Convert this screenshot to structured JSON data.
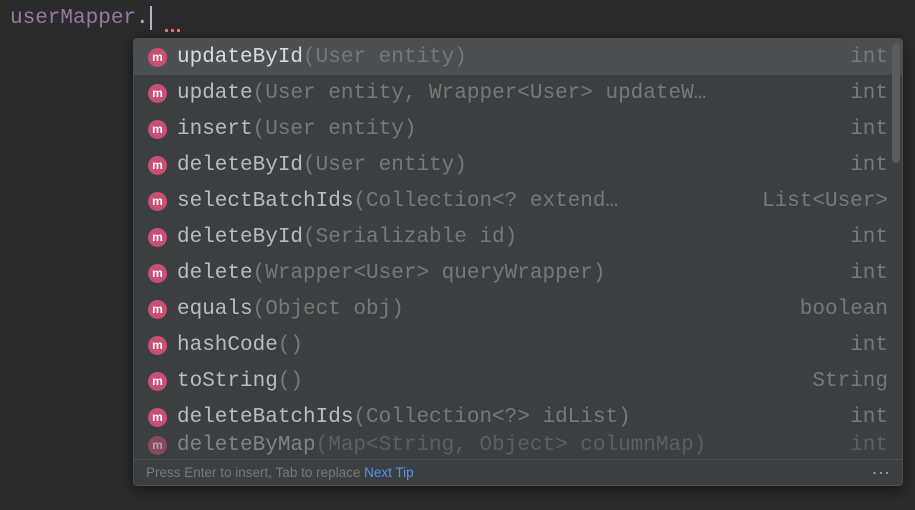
{
  "editor": {
    "identifier": "userMapper",
    "dot": "."
  },
  "popup": {
    "items": [
      {
        "icon": "m",
        "name": "updateById",
        "params": "(User entity)",
        "ret": "int",
        "selected": true
      },
      {
        "icon": "m",
        "name": "update",
        "params": "(User entity, Wrapper<User> updateW…",
        "ret": "int"
      },
      {
        "icon": "m",
        "name": "insert",
        "params": "(User entity)",
        "ret": "int"
      },
      {
        "icon": "m",
        "name": "deleteById",
        "params": "(User entity)",
        "ret": "int"
      },
      {
        "icon": "m",
        "name": "selectBatchIds",
        "params": "(Collection<? extend…",
        "ret": "List<User>"
      },
      {
        "icon": "m",
        "name": "deleteById",
        "params": "(Serializable id)",
        "ret": "int"
      },
      {
        "icon": "m",
        "name": "delete",
        "params": "(Wrapper<User> queryWrapper)",
        "ret": "int"
      },
      {
        "icon": "m",
        "name": "equals",
        "params": "(Object obj)",
        "ret": "boolean"
      },
      {
        "icon": "m",
        "name": "hashCode",
        "params": "()",
        "ret": "int"
      },
      {
        "icon": "m",
        "name": "toString",
        "params": "()",
        "ret": "String"
      },
      {
        "icon": "m",
        "name": "deleteBatchIds",
        "params": "(Collection<?> idList)",
        "ret": "int"
      },
      {
        "icon": "m",
        "name": "deleteByMap",
        "params": "(Map<String, Object> columnMap)",
        "ret": "int",
        "partial": true
      }
    ],
    "footer": {
      "hint": "Press Enter to insert, Tab to replace",
      "next_tip": "Next Tip"
    }
  }
}
